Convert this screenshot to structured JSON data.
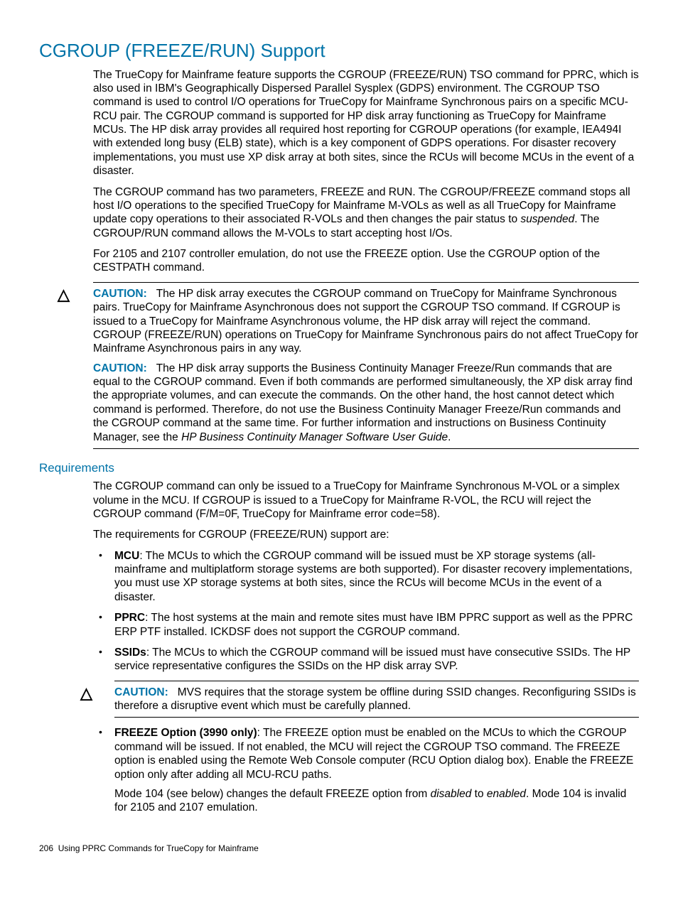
{
  "title": "CGROUP (FREEZE/RUN) Support",
  "paragraphs": {
    "p1": "The TrueCopy for Mainframe feature supports the CGROUP (FREEZE/RUN) TSO command for PPRC, which is also used in IBM's Geographically Dispersed Parallel Sysplex (GDPS) environment. The CGROUP TSO command is used to control I/O operations for TrueCopy for Mainframe Synchronous pairs on a specific MCU-RCU pair. The CGROUP command is supported for HP disk array functioning as TrueCopy for Mainframe MCUs. The HP disk array provides all required host reporting for CGROUP operations (for example, IEA494I with extended long busy (ELB) state), which is a key component of GDPS operations. For disaster recovery implementations, you must use XP disk array at both sites, since the RCUs will become MCUs in the event of a disaster.",
    "p2a": "The CGROUP command has two parameters, FREEZE and RUN. The CGROUP/FREEZE command stops all host I/O operations to the specified TrueCopy for Mainframe M-VOLs as well as all TrueCopy for Mainframe update copy operations to their associated R-VOLs and then changes the pair status to ",
    "p2b_italic": "suspended",
    "p2c": ". The CGROUP/RUN command allows the M-VOLs to start accepting host I/Os.",
    "p3": "For 2105 and 2107 controller emulation, do not use the FREEZE option. Use the CGROUP option of the CESTPATH command."
  },
  "caution1": {
    "label": "CAUTION:",
    "text1": "The HP disk array executes the CGROUP command on TrueCopy for Mainframe Synchronous pairs. TrueCopy for Mainframe Asynchronous does not support the CGROUP TSO command. If CGROUP is issued to a TrueCopy for Mainframe Asynchronous volume, the HP disk array will reject the command. CGROUP (FREEZE/RUN) operations on TrueCopy for Mainframe Synchronous pairs do not affect TrueCopy for Mainframe Asynchronous pairs in any way.",
    "text2a": "The HP disk array supports the Business Continuity Manager Freeze/Run commands that are equal to the CGROUP command. Even if both commands are performed simultaneously, the XP disk array find the appropriate volumes, and can execute the commands. On the other hand, the host cannot detect which command is performed. Therefore, do not use the Business Continuity Manager Freeze/Run commands and the CGROUP command at the same time. For further information and instructions on Business Continuity Manager, see the ",
    "text2b_italic": "HP Business Continuity Manager Software User Guide",
    "text2c": "."
  },
  "requirements": {
    "heading": "Requirements",
    "p1": "The CGROUP command can only be issued to a TrueCopy for Mainframe Synchronous M-VOL or a simplex volume in the MCU. If CGROUP is issued to a TrueCopy for Mainframe R-VOL, the RCU will reject the CGROUP command (F/M=0F, TrueCopy for Mainframe error code=58).",
    "p2": "The requirements for CGROUP (FREEZE/RUN) support are:",
    "items": {
      "mcu_label": "MCU",
      "mcu_text": ": The MCUs to which the CGROUP command will be issued must be XP storage systems (all-mainframe and multiplatform storage systems are both supported). For disaster recovery implementations, you must use XP storage systems at both sites, since the RCUs will become MCUs in the event of a disaster.",
      "pprc_label": "PPRC",
      "pprc_text": ": The host systems at the main and remote sites must have IBM PPRC support as well as the PPRC ERP PTF installed. ICKDSF does not support the CGROUP command.",
      "ssids_label": "SSIDs",
      "ssids_text": ": The MCUs to which the CGROUP command will be issued must have consecutive SSIDs. The HP service representative configures the SSIDs on the HP disk array SVP.",
      "ssids_caution_label": "CAUTION:",
      "ssids_caution_text": "MVS requires that the storage system be offline during SSID changes. Reconfiguring SSIDs is therefore a disruptive event which must be carefully planned.",
      "freeze_label": "FREEZE Option (3990 only)",
      "freeze_text": ": The FREEZE option must be enabled on the MCUs to which the CGROUP command will be issued. If not enabled, the MCU will reject the CGROUP TSO command. The FREEZE option is enabled using the Remote Web Console computer (RCU Option dialog box). Enable the FREEZE option only after adding all MCU-RCU paths.",
      "freeze_p2a": "Mode 104 (see below) changes the default FREEZE option from ",
      "freeze_p2b_italic": "disabled",
      "freeze_p2c": " to ",
      "freeze_p2d_italic": "enabled",
      "freeze_p2e": ". Mode 104 is invalid for 2105 and 2107 emulation."
    }
  },
  "footer": {
    "page": "206",
    "text": "Using PPRC Commands for TrueCopy for Mainframe"
  }
}
